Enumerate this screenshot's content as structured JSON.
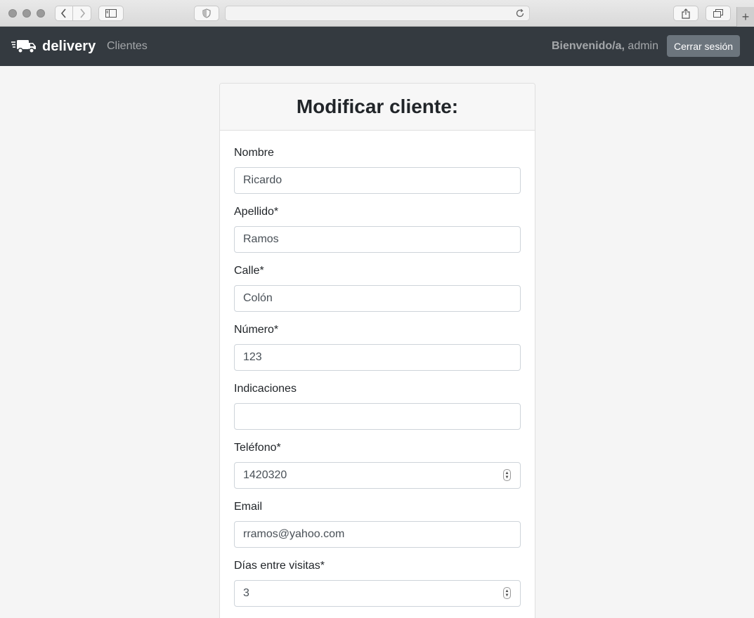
{
  "browser": {
    "new_tab": "+"
  },
  "navbar": {
    "brand": "delivery",
    "nav_link": "Clientes",
    "welcome_bold": "Bienvenido/a,",
    "welcome_user": " admin",
    "logout": "Cerrar sesión"
  },
  "form": {
    "title": "Modificar cliente:",
    "fields": [
      {
        "label": "Nombre",
        "value": "Ricardo"
      },
      {
        "label": "Apellido*",
        "value": "Ramos"
      },
      {
        "label": "Calle*",
        "value": "Colón"
      },
      {
        "label": "Número*",
        "value": "123"
      },
      {
        "label": "Indicaciones",
        "value": ""
      },
      {
        "label": "Teléfono*",
        "value": "1420320"
      },
      {
        "label": "Email",
        "value": "rramos@yahoo.com"
      },
      {
        "label": "Días entre visitas*",
        "value": "3"
      }
    ]
  },
  "colors": {
    "navbar_bg": "#343a40",
    "logout_bg": "#6c757d",
    "page_bg": "#f5f5f5"
  }
}
